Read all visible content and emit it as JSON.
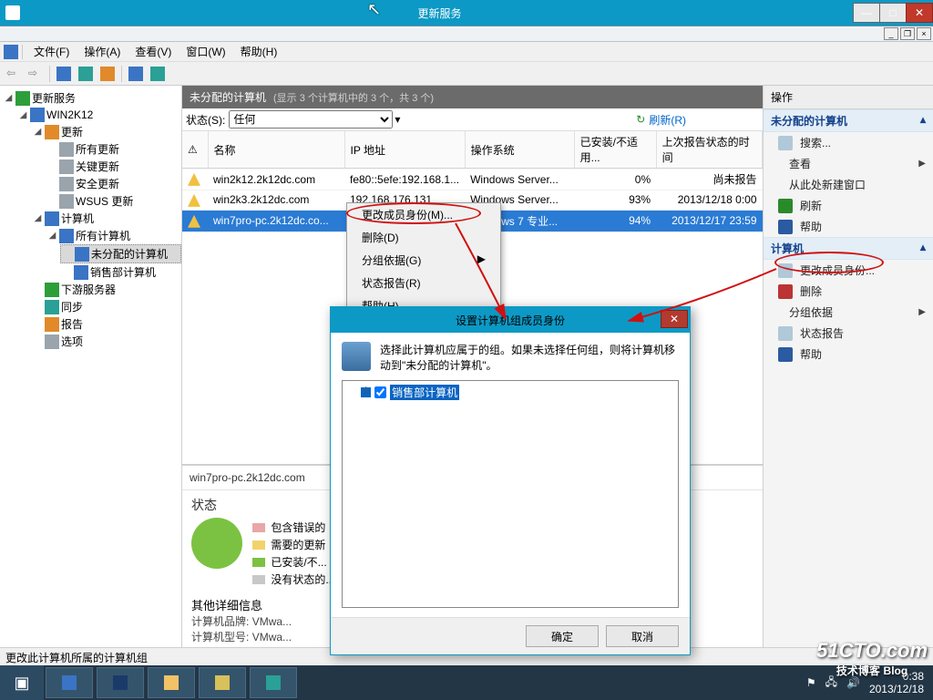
{
  "window": {
    "title": "更新服务"
  },
  "menus": {
    "file": "文件(F)",
    "action": "操作(A)",
    "view": "查看(V)",
    "window": "窗口(W)",
    "help": "帮助(H)"
  },
  "tree": {
    "root": "更新服务",
    "server": "WIN2K12",
    "updates": "更新",
    "all_updates": "所有更新",
    "critical": "关键更新",
    "security": "安全更新",
    "wsus": "WSUS 更新",
    "computers": "计算机",
    "all_computers": "所有计算机",
    "unassigned": "未分配的计算机",
    "sales": "销售部计算机",
    "downstream": "下游服务器",
    "sync": "同步",
    "reports": "报告",
    "options": "选项"
  },
  "list": {
    "header_title": "未分配的计算机",
    "header_sub": "(显示 3 个计算机中的 3 个，共 3 个)",
    "status_label": "状态(S):",
    "status_value": "任何",
    "refresh": "刷新(R)",
    "cols": {
      "name": "名称",
      "ip": "IP 地址",
      "os": "操作系统",
      "installed": "已安装/不适用...",
      "last_report": "上次报告状态的时间"
    },
    "rows": [
      {
        "name": "win2k12.2k12dc.com",
        "ip": "fe80::5efe:192.168.1...",
        "os": "Windows Server...",
        "installed": "0%",
        "last_report": "尚未报告"
      },
      {
        "name": "win2k3.2k12dc.com",
        "ip": "192.168.176.131",
        "os": "Windows Server...",
        "installed": "93%",
        "last_report": "2013/12/18 0:00"
      },
      {
        "name": "win7pro-pc.2k12dc.co...",
        "ip": "192.168.176.103",
        "os": "Windows 7 专业...",
        "installed": "94%",
        "last_report": "2013/12/17 23:59"
      }
    ]
  },
  "ctx": {
    "change_membership": "更改成员身份(M)...",
    "delete": "删除(D)",
    "group_by": "分组依据(G)",
    "status_report": "状态报告(R)",
    "help": "帮助(H)"
  },
  "detail": {
    "computer": "win7pro-pc.2k12dc.com",
    "status_h": "状态",
    "legend": {
      "errors": "包含错误的",
      "needed": "需要的更新",
      "installed": "已安装/不...",
      "nostatus": "没有状态的..."
    },
    "other_h": "其他详细信息",
    "brand_l": "计算机品牌:",
    "brand_v": "VMwa...",
    "model_l": "计算机型号:",
    "model_v": "VMwa..."
  },
  "actions": {
    "title": "操作",
    "sec1": "未分配的计算机",
    "search": "搜索...",
    "view": "查看",
    "new_window": "从此处新建窗口",
    "refresh": "刷新",
    "help": "帮助",
    "sec2": "计算机",
    "change_membership": "更改成员身份...",
    "delete2": "删除",
    "group_by2": "分组依据",
    "status_report2": "状态报告",
    "help2": "帮助"
  },
  "dialog": {
    "title": "设置计算机组成员身份",
    "text": "选择此计算机应属于的组。如果未选择任何组，则将计算机移动到\"未分配的计算机\"。",
    "group": "销售部计算机",
    "ok": "确定",
    "cancel": "取消"
  },
  "statusbar": "更改此计算机所属的计算机组",
  "tray": {
    "time": "0:38",
    "date": "2013/12/18"
  },
  "watermark": {
    "line1": "51CTO.com",
    "line2": "技术博客",
    "line3": "Blog"
  }
}
